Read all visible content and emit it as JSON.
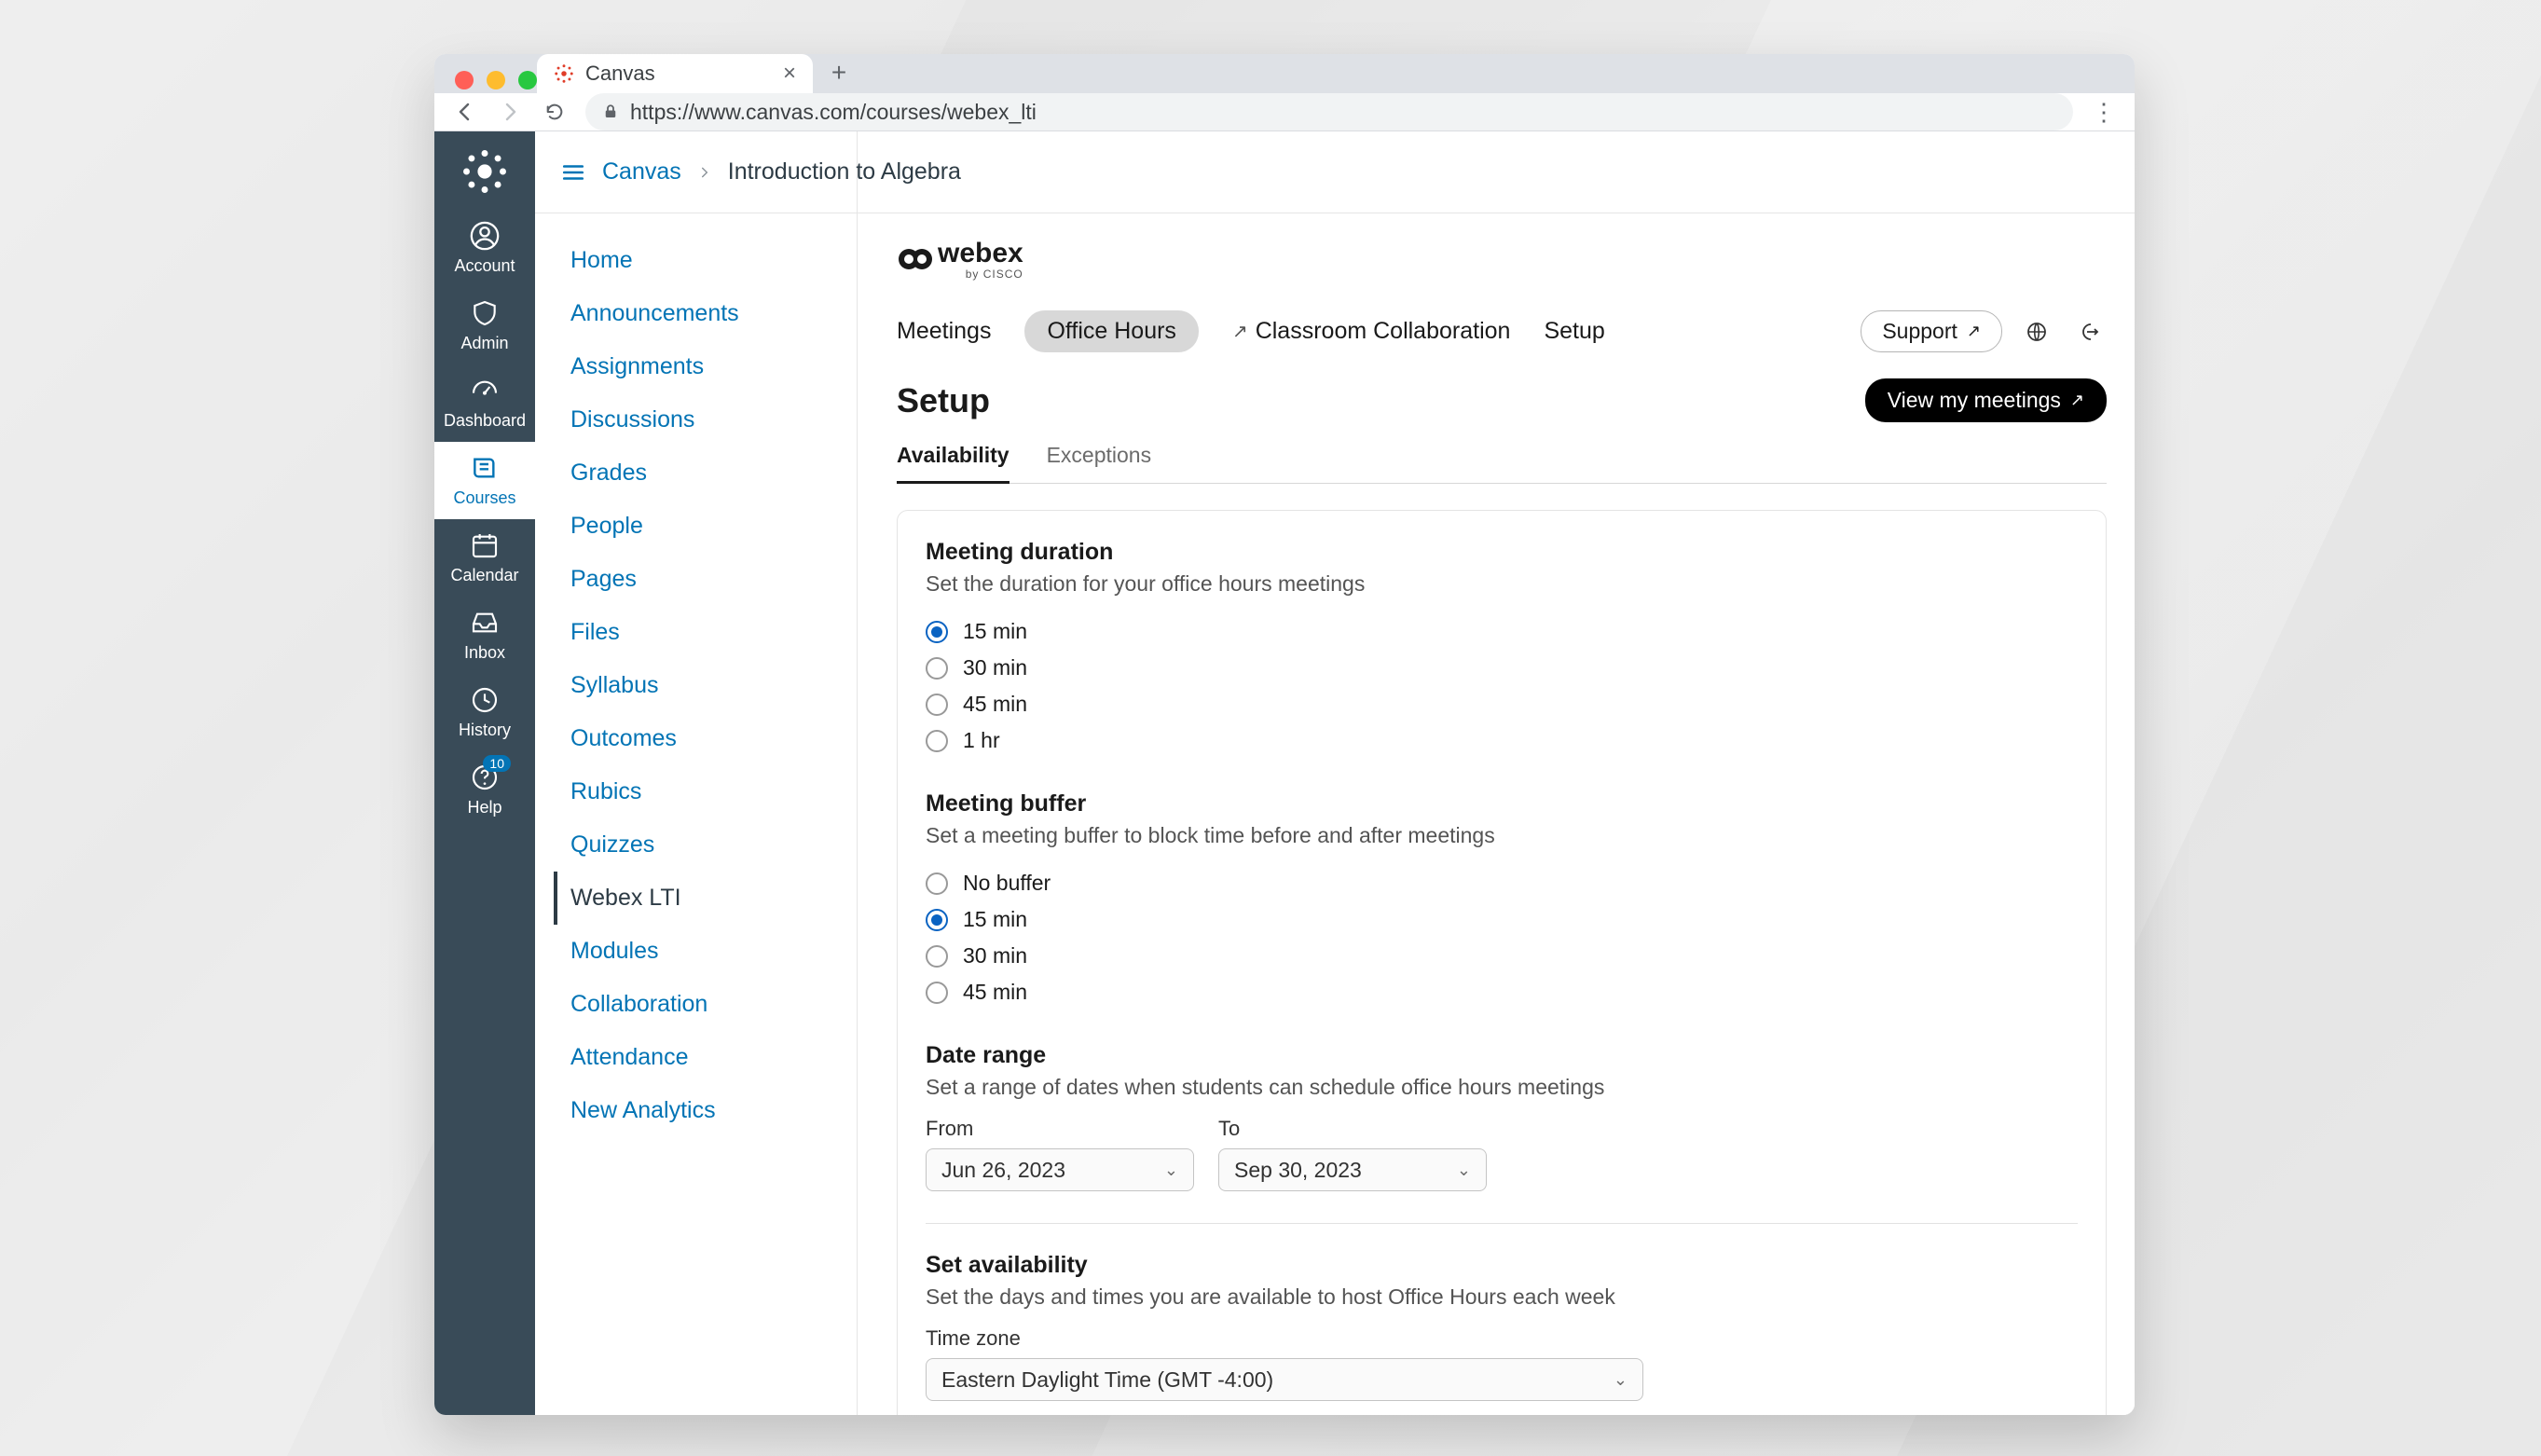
{
  "browser": {
    "tab_title": "Canvas",
    "url": "https://www.canvas.com/courses/webex_lti"
  },
  "rail": {
    "items": [
      {
        "id": "account",
        "label": "Account"
      },
      {
        "id": "admin",
        "label": "Admin"
      },
      {
        "id": "dashboard",
        "label": "Dashboard"
      },
      {
        "id": "courses",
        "label": "Courses"
      },
      {
        "id": "calendar",
        "label": "Calendar"
      },
      {
        "id": "inbox",
        "label": "Inbox"
      },
      {
        "id": "history",
        "label": "History"
      },
      {
        "id": "help",
        "label": "Help"
      }
    ],
    "help_badge": "10"
  },
  "breadcrumb": {
    "root": "Canvas",
    "course": "Introduction to Algebra"
  },
  "course_nav": [
    "Home",
    "Announcements",
    "Assignments",
    "Discussions",
    "Grades",
    "People",
    "Pages",
    "Files",
    "Syllabus",
    "Outcomes",
    "Rubics",
    "Quizzes",
    "Webex LTI",
    "Modules",
    "Collaboration",
    "Attendance",
    "New Analytics"
  ],
  "course_nav_active": "Webex LTI",
  "webex": {
    "brand": "webex",
    "brand_sub": "by CISCO",
    "tabs": {
      "meetings": "Meetings",
      "office_hours": "Office Hours",
      "classroom": "Classroom Collaboration",
      "setup": "Setup"
    },
    "support": "Support",
    "page_title": "Setup",
    "view_meetings": "View my meetings",
    "sub_tabs": {
      "availability": "Availability",
      "exceptions": "Exceptions"
    },
    "duration": {
      "title": "Meeting duration",
      "desc": "Set the duration for your office hours meetings",
      "options": [
        "15 min",
        "30 min",
        "45 min",
        "1 hr"
      ],
      "selected": "15 min"
    },
    "buffer": {
      "title": "Meeting buffer",
      "desc": "Set a meeting buffer to block time before and after meetings",
      "options": [
        "No buffer",
        "15 min",
        "30 min",
        "45 min"
      ],
      "selected": "15 min"
    },
    "date_range": {
      "title": "Date range",
      "desc": "Set a range of dates when students can schedule office hours meetings",
      "from_label": "From",
      "to_label": "To",
      "from": "Jun 26, 2023",
      "to": "Sep 30, 2023"
    },
    "availability": {
      "title": "Set availability",
      "desc": "Set the days and times you are available to host Office Hours each week",
      "tz_label": "Time zone",
      "tz_value": "Eastern Daylight Time (GMT -4:00)"
    }
  }
}
